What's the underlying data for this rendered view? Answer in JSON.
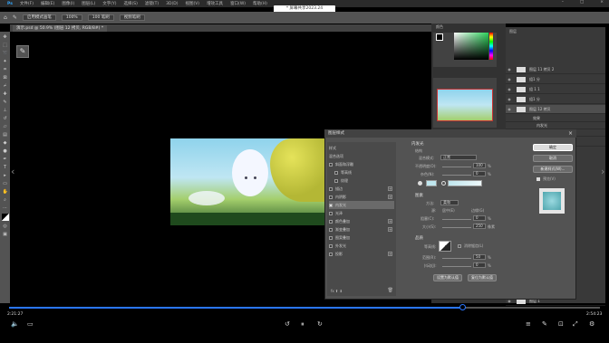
{
  "menubar": {
    "items": [
      "文件(F)",
      "编辑(E)",
      "图像(I)",
      "图层(L)",
      "文字(Y)",
      "选择(S)",
      "滤镜(T)",
      "3D(D)",
      "视图(V)",
      "增效工具",
      "窗口(W)",
      "帮助(H)"
    ]
  },
  "notice": "* 屏幕共享2023.24",
  "optbar": {
    "chips": [
      "启用模式画笔",
      "100%",
      "100 笔刷",
      "视频笔刷"
    ]
  },
  "document_tab": "演示.psd @ 50.9% (图层 12 拷贝, RGB/8#) *",
  "panels": {
    "color_title": "颜色",
    "navigator_title": "导航器",
    "layers_title": "图层"
  },
  "layers": [
    {
      "name": "图层 11 拷贝 2"
    },
    {
      "name": "组1 分"
    },
    {
      "name": "组 1 1"
    },
    {
      "name": "组1 分"
    },
    {
      "name": "图层 12 拷贝"
    },
    {
      "name": "效果"
    },
    {
      "name": "内发光"
    },
    {
      "name": "外发光"
    },
    {
      "name": "组1 18"
    },
    {
      "name": "图层 1"
    },
    {
      "name": "背景"
    }
  ],
  "dialog": {
    "title": "图层样式",
    "list_header": "样式",
    "list": [
      {
        "label": "混合选项",
        "checked": false,
        "plus": false
      },
      {
        "label": "斜面和浮雕",
        "checked": false,
        "plus": false
      },
      {
        "label": "等高线",
        "checked": false,
        "plus": false
      },
      {
        "label": "纹理",
        "checked": false,
        "plus": false
      },
      {
        "label": "描边",
        "checked": false,
        "plus": true
      },
      {
        "label": "内阴影",
        "checked": false,
        "plus": true
      },
      {
        "label": "内发光",
        "checked": true,
        "plus": false
      },
      {
        "label": "光泽",
        "checked": false,
        "plus": false
      },
      {
        "label": "颜色叠加",
        "checked": false,
        "plus": true
      },
      {
        "label": "渐变叠加",
        "checked": false,
        "plus": true
      },
      {
        "label": "图案叠加",
        "checked": false,
        "plus": false
      },
      {
        "label": "外发光",
        "checked": false,
        "plus": false
      },
      {
        "label": "投影",
        "checked": false,
        "plus": true
      }
    ],
    "section_inner_glow": "内发光",
    "section_structure": "结构",
    "blend_mode_label": "混合模式:",
    "blend_mode_value": "正常",
    "opacity_label": "不透明度(O):",
    "opacity_value": "100",
    "noise_label": "杂色(N):",
    "noise_value": "0",
    "section_elements": "图素",
    "method_label": "方法:",
    "method_value": "柔和",
    "source_label": "源:",
    "source_center": "居中(E)",
    "source_edge": "边缘(G)",
    "choke_label": "阻塞(C):",
    "choke_value": "0",
    "size_label": "大小(S):",
    "size_value": "250",
    "size_unit": "像素",
    "section_quality": "品质",
    "contour_label": "等高线:",
    "antialias_label": "消除锯齿(L)",
    "range_label": "范围(R):",
    "range_value": "50",
    "jitter_label": "抖动(J):",
    "jitter_value": "0",
    "default_btn": "设置为默认值",
    "reset_btn": "复位为默认值",
    "ok_btn": "确定",
    "cancel_btn": "取消",
    "new_style_btn": "新建样式(W)...",
    "preview_label": "预览(V)",
    "percent": "%"
  },
  "video": {
    "elapsed": "2:21:27",
    "total": "2:54:23",
    "progress": 0.767
  },
  "colors": {
    "accent": "#2a76ff",
    "glow": "#bfe6ee"
  }
}
